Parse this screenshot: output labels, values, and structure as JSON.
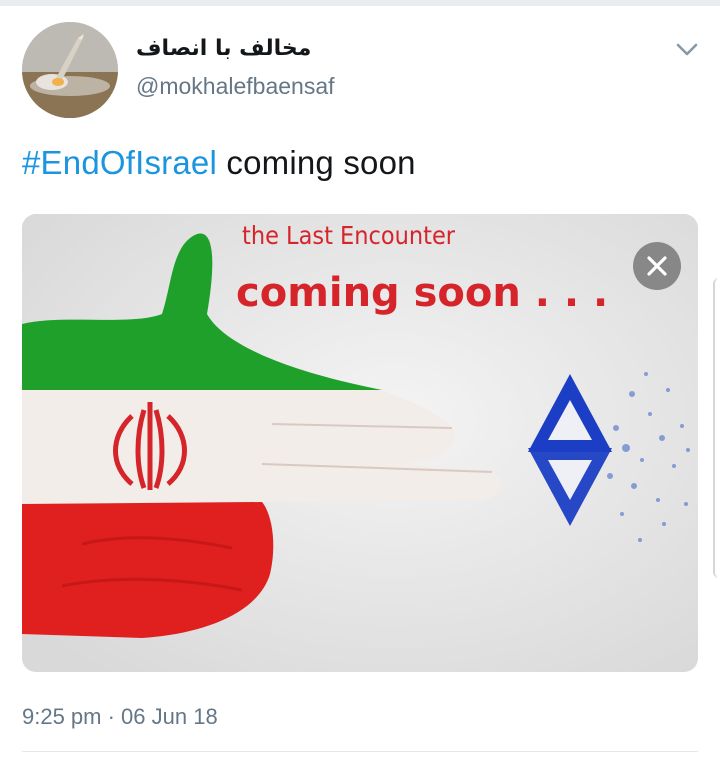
{
  "tweet": {
    "display_name": "مخالف با انصاف",
    "handle": "@mokhalefbaensaf",
    "hashtag": "#EndOfIsrael",
    "text_rest": " coming soon",
    "timestamp": "9:25 pm · 06 Jun 18"
  },
  "media": {
    "line1": "the Last Encounter",
    "line2": "coming soon . . .",
    "colors": {
      "green": "#1fa02a",
      "white": "#f2ede9",
      "red": "#e01f1f",
      "blue": "#1b3ec4",
      "title_red": "#d6252a"
    }
  },
  "icons": {
    "avatar": "avatar-photo",
    "menu": "chevron-down-icon",
    "close": "close-icon"
  }
}
